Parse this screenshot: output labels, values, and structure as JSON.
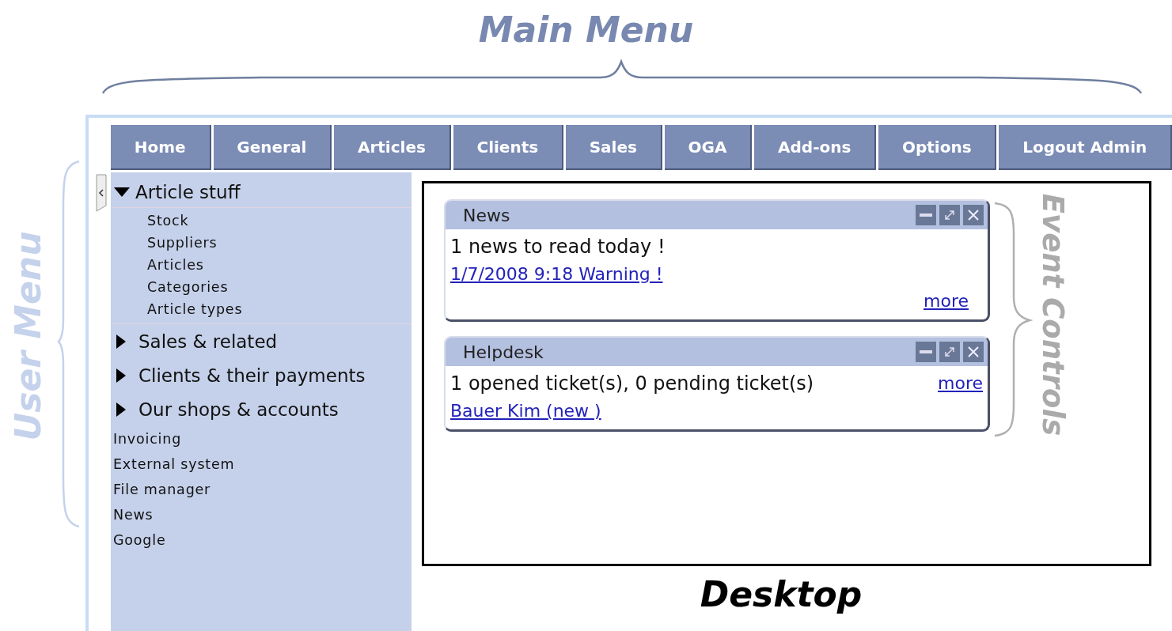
{
  "annotations": {
    "main_menu": "Main Menu",
    "user_menu": "User Menu",
    "event_controls": "Event Controls",
    "desktop": "Desktop"
  },
  "main_menu": [
    {
      "label": "Home"
    },
    {
      "label": "General"
    },
    {
      "label": "Articles"
    },
    {
      "label": "Clients"
    },
    {
      "label": "Sales"
    },
    {
      "label": "OGA"
    },
    {
      "label": "Add-ons"
    },
    {
      "label": "Options"
    },
    {
      "label": "Logout Admin"
    }
  ],
  "user_menu": [
    {
      "label": "Article stuff",
      "kind": "group",
      "expanded": true,
      "children": [
        {
          "label": "Stock"
        },
        {
          "label": "Suppliers"
        },
        {
          "label": "Articles"
        },
        {
          "label": "Categories"
        },
        {
          "label": "Article types"
        }
      ]
    },
    {
      "label": "Sales & related",
      "kind": "group",
      "expanded": false
    },
    {
      "label": "Clients & their payments",
      "kind": "group",
      "expanded": false
    },
    {
      "label": "Our shops & accounts",
      "kind": "group",
      "expanded": false
    },
    {
      "label": "Invoicing",
      "kind": "link"
    },
    {
      "label": "External system",
      "kind": "link"
    },
    {
      "label": "File manager",
      "kind": "link"
    },
    {
      "label": "News",
      "kind": "link"
    },
    {
      "label": "Google",
      "kind": "link"
    }
  ],
  "widgets": [
    {
      "title": "News",
      "lines": [
        {
          "kind": "text",
          "text": "1 news to read today !"
        },
        {
          "kind": "link",
          "text": "1/7/2008 9:18 Warning !"
        },
        {
          "kind": "more",
          "text": "more"
        }
      ]
    },
    {
      "title": "Helpdesk",
      "lines": [
        {
          "kind": "text",
          "text": "1 opened ticket(s), 0 pending ticket(s)",
          "more": "more"
        },
        {
          "kind": "link",
          "text": "Bauer Kim (new )"
        }
      ]
    }
  ]
}
